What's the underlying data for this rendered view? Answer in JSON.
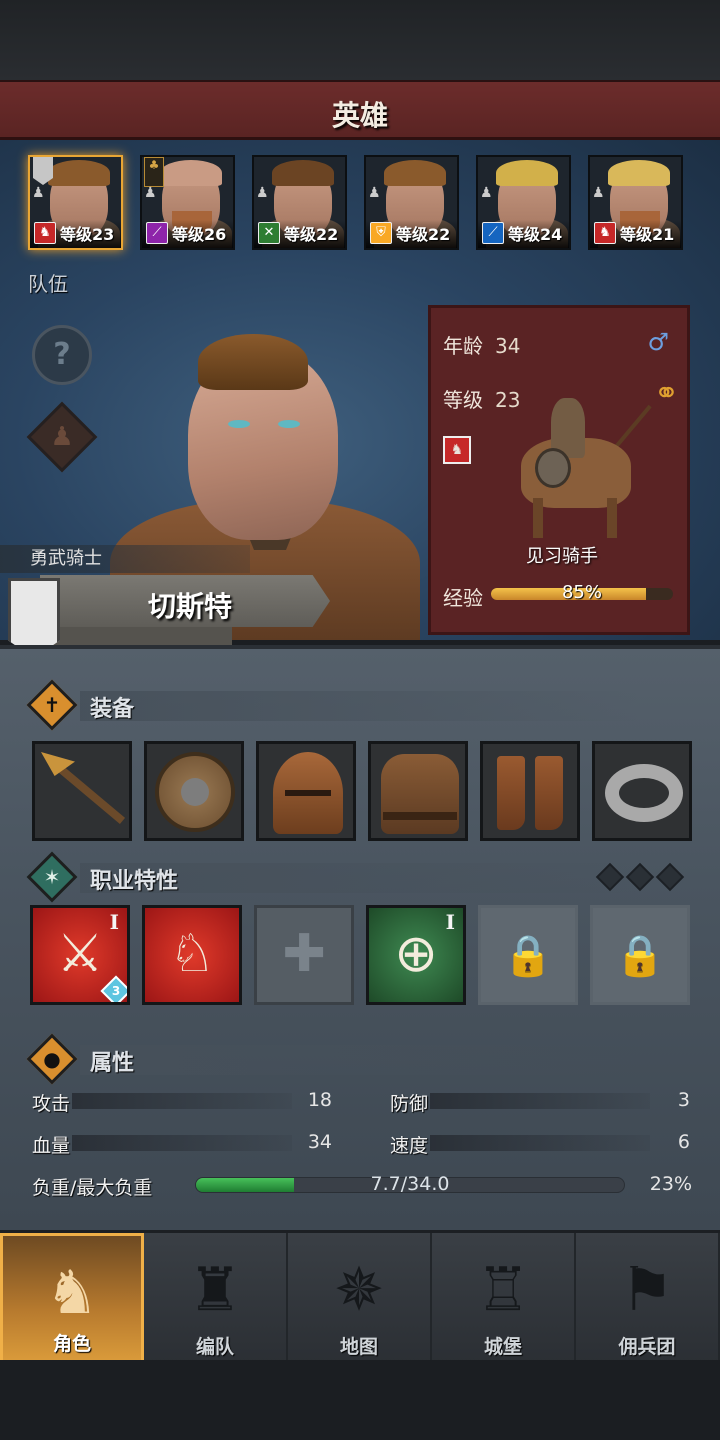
{
  "header": {
    "title": "英雄"
  },
  "roster": [
    {
      "level_text": "等级23",
      "class_color": "#c62828",
      "class_glyph": "♞",
      "hair": "#8a5a2c",
      "beard": false,
      "selected": true,
      "flag": "banner"
    },
    {
      "level_text": "等级26",
      "class_color": "#8e24aa",
      "class_glyph": "⟋",
      "hair": "#c99b84",
      "beard": true,
      "selected": false,
      "flag": "tree"
    },
    {
      "level_text": "等级22",
      "class_color": "#2e7d32",
      "class_glyph": "✕",
      "hair": "#6b4423",
      "beard": false,
      "selected": false,
      "flag": ""
    },
    {
      "level_text": "等级22",
      "class_color": "#f9a825",
      "class_glyph": "⛨",
      "hair": "#8a5a2c",
      "beard": false,
      "selected": false,
      "flag": ""
    },
    {
      "level_text": "等级24",
      "class_color": "#1565c0",
      "class_glyph": "⟋",
      "hair": "#d2b04a",
      "beard": false,
      "selected": false,
      "flag": ""
    },
    {
      "level_text": "等级21",
      "class_color": "#c62828",
      "class_glyph": "♞",
      "hair": "#d9b85a",
      "beard": true,
      "selected": false,
      "flag": ""
    }
  ],
  "team_label": "队伍",
  "hero": {
    "class_title": "勇武骑士",
    "name": "切斯特",
    "age_label": "年龄",
    "age": "34",
    "level_label": "等级",
    "level": "23",
    "gender_icon": "male-icon",
    "gender_symbol": "♂",
    "rank": "见习骑手",
    "exp_label": "经验",
    "exp_text": "85%",
    "exp_percent": 85
  },
  "equipment": {
    "label": "装备",
    "items": [
      "spear",
      "round-shield",
      "helmet",
      "leather-armor",
      "boots",
      "ring"
    ]
  },
  "traits": {
    "label": "职业特性",
    "slots": [
      {
        "type": "red",
        "glyph": "⚔",
        "roman": "I",
        "badge": "3"
      },
      {
        "type": "red",
        "glyph": "♘",
        "roman": "",
        "badge": ""
      },
      {
        "type": "empty",
        "glyph": "✚",
        "roman": "",
        "badge": ""
      },
      {
        "type": "green",
        "glyph": "⊕",
        "roman": "I",
        "badge": ""
      },
      {
        "type": "locked",
        "glyph": "🔒",
        "roman": "",
        "badge": ""
      },
      {
        "type": "locked",
        "glyph": "🔒",
        "roman": "",
        "badge": ""
      }
    ]
  },
  "attributes": {
    "label": "属性",
    "attack_label": "攻击",
    "attack": "18",
    "defense_label": "防御",
    "defense": "3",
    "hp_label": "血量",
    "hp": "34",
    "speed_label": "速度",
    "speed": "6",
    "weight_label": "负重/最大负重",
    "weight_text": "7.7/34.0",
    "weight_percent_text": "23%",
    "weight_fraction": 0.23
  },
  "nav": [
    {
      "label": "角色",
      "active": true,
      "icon": "knight-icon"
    },
    {
      "label": "编队",
      "active": false,
      "icon": "squad-icon"
    },
    {
      "label": "地图",
      "active": false,
      "icon": "compass-icon"
    },
    {
      "label": "城堡",
      "active": false,
      "icon": "castle-icon"
    },
    {
      "label": "佣兵团",
      "active": false,
      "icon": "mercenary-icon"
    }
  ],
  "colors": {
    "title_bar": "#6c2c2b",
    "info_panel": "#5a2324",
    "accent_gold": "#e9a634",
    "exp_fill": "#f4c34a",
    "weight_fill": "#47c15a"
  }
}
